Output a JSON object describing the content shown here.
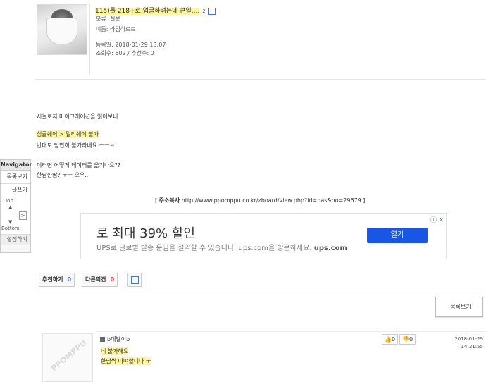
{
  "post": {
    "title": "115)를 218+로 업글하려는데 큰일....",
    "reply_count": "2",
    "category": "분류: 질문",
    "name": "이름: 라임하르트",
    "registered": "등록일: 2018-01-29 13:07",
    "stats": "조회수: 602 / 추천수: 0"
  },
  "body": {
    "line1": "시놀로지 마이그레이션을 읽어보니",
    "line2": "싱글쉐어 > 멀티쉐어 불가",
    "line3": "반대도 당연히 불가라네요 ㅡㅡㅋ",
    "line4": "이러면 어떻게 데이터를 옮기나요??",
    "line5": "한땀한땀? ㅜㅜ 오우...",
    "source_label": "주소복사",
    "source_url": "http://www.ppomppu.co.kr/zboard/view.php?id=nas&no=29679",
    "source_open": "[",
    "source_close": "]"
  },
  "navigator": {
    "title": "Navigator",
    "list": "목록보기",
    "write": "글쓰기",
    "top": "Top",
    "bottom": "Bottom",
    "settings": "설정하기"
  },
  "ad": {
    "headline": "로 최대 39% 할인",
    "subtext": "UPS로 글로벌 발송 운임을 절약할 수 있습니다. ups.com을 방문하세요.",
    "domain": "ups.com",
    "button": "열기",
    "info": "ⓘ ✕"
  },
  "actions": {
    "recommend_label": "추천하기",
    "recommend_count": "0",
    "dissent_label": "다른의견",
    "dissent_count": "0",
    "list_button": "목록보기"
  },
  "comment": {
    "author": "b데벨이b",
    "line1": "네 불가해요",
    "line2": "한땀씩 따야합니다 ㅜ",
    "up_count": "0",
    "down_count": "0",
    "date": "2018-01-29",
    "time": "14:31:55",
    "watermark": "PPOMPPU"
  },
  "colors": {
    "highlight": "#fff7a0",
    "link_blue": "#4a7bc1",
    "ad_button": "#1a56e6",
    "dissent_red": "#dd2222"
  }
}
